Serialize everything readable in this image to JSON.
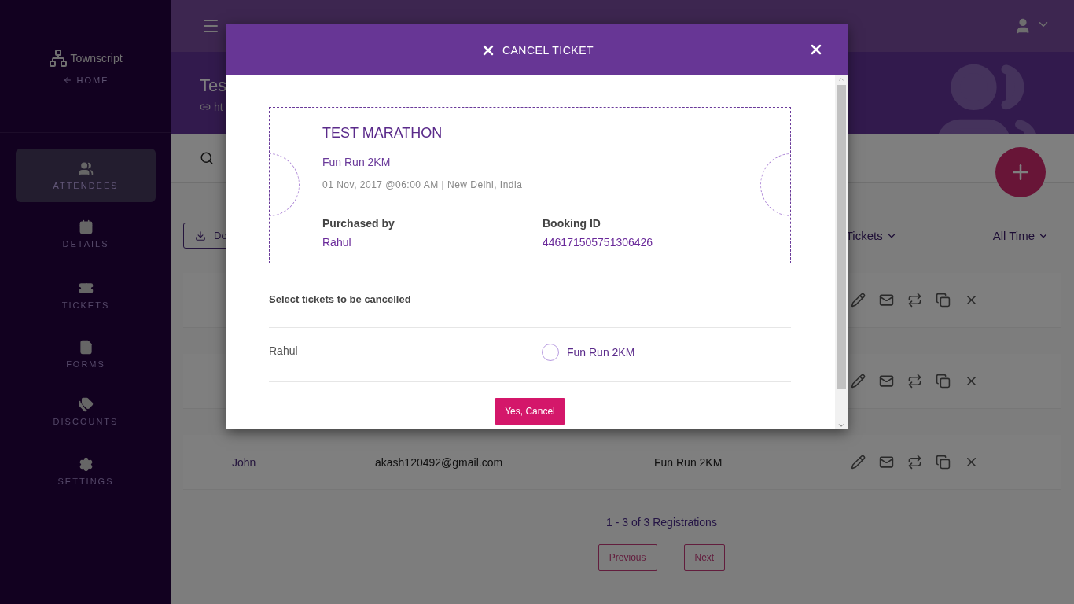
{
  "sidebar": {
    "brand": "Townscript",
    "home_link": "HOME",
    "items": [
      {
        "label": "ATTENDEES",
        "selected": true
      },
      {
        "label": "DETAILS",
        "selected": false
      },
      {
        "label": "TICKETS",
        "selected": false
      },
      {
        "label": "FORMS",
        "selected": false
      },
      {
        "label": "DISCOUNTS",
        "selected": false
      },
      {
        "label": "SETTINGS",
        "selected": false
      }
    ]
  },
  "header": {
    "title": "Tes",
    "link": "ht"
  },
  "toolbar": {
    "download_button": "Do",
    "ticket_filter": "Tickets",
    "time_filter": "All Time"
  },
  "rows": [
    {
      "kind": "covered"
    },
    {
      "kind": "covered"
    },
    {
      "kind": "full",
      "name": "John",
      "email": "akash120492@gmail.com",
      "ticket": "Fun Run 2KM"
    }
  ],
  "pagination": {
    "summary": "1 - 3 of 3 Registrations",
    "previous": "Previous",
    "next": "Next"
  },
  "dialog": {
    "title": "CANCEL TICKET",
    "event": {
      "name": "TEST MARATHON",
      "ticket": "Fun Run 2KM",
      "when_where": "01 Nov, 2017 @06:00 AM | New Delhi, India",
      "purchased_by_label": "Purchased by",
      "purchased_by": "Rahul",
      "booking_id_label": "Booking ID",
      "booking_id": "446171505751306426"
    },
    "prompt": "Select tickets to be cancelled",
    "attendees": [
      {
        "name": "Rahul",
        "ticket": "Fun Run 2KM",
        "selected": false
      }
    ],
    "confirm_button": "Yes, Cancel"
  }
}
